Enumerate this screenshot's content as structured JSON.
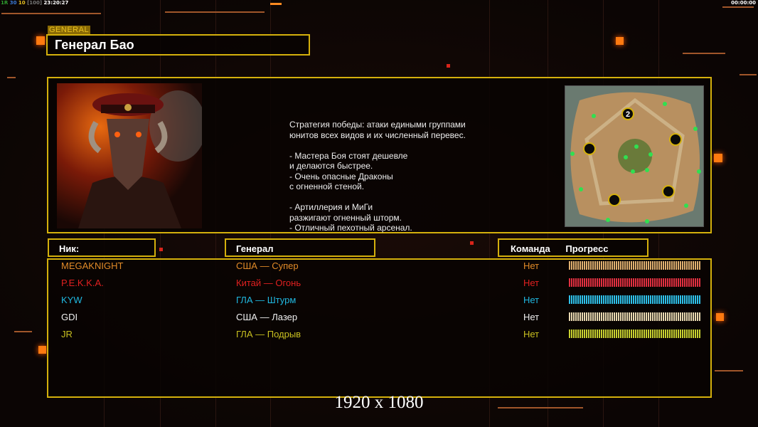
{
  "status_bar": {
    "left_parts": [
      {
        "text": "1R",
        "color": "#2fa02f"
      },
      {
        "text": "30",
        "color": "#3a7ad8"
      },
      {
        "text": "10",
        "color": "#e8c020"
      },
      {
        "text": "[100]",
        "color": "#777"
      },
      {
        "text": "23:20:27",
        "color": "#fff"
      }
    ],
    "right_time": "00:00:00"
  },
  "header": {
    "tag": "GENERAL",
    "title": "Генерал Бао"
  },
  "description": [
    "Стратегия победы: атаки едиными группами",
    "юнитов всех видов и их численный перевес.",
    "",
    "- Мастера Боя стоят дешевле",
    "и делаются быстрее.",
    "- Очень опасные Драконы",
    "с огненной стеной.",
    "",
    "- Артиллерия и МиГи",
    "разжигают огненный шторм.",
    "- Отличный пехотный арсенал."
  ],
  "map": {
    "player_marker": "2"
  },
  "columns": {
    "nick": "Ник:",
    "general": "Генерал",
    "team": "Команда",
    "progress": "Прогресс"
  },
  "players": [
    {
      "nick": "MEGAKNIGHT",
      "general": "США — Супер",
      "team": "Нет",
      "color": "#e08a28",
      "progress": 100
    },
    {
      "nick": "P.E.K.K.A.",
      "general": "Китай — Огонь",
      "team": "Нет",
      "color": "#e02020",
      "progress": 100
    },
    {
      "nick": "KYW",
      "general": "ГЛА — Штурм",
      "team": "Нет",
      "color": "#20b8e0",
      "progress": 100
    },
    {
      "nick": "GDI",
      "general": "США — Лазер",
      "team": "Нет",
      "color": "#f0f0f0",
      "progress": 100
    },
    {
      "nick": "JR",
      "general": "ГЛА — Подрыв",
      "team": "Нет",
      "color": "#c8c020",
      "progress": 100
    }
  ],
  "bar_colors": [
    "#e0b070",
    "#e03040",
    "#30c0e8",
    "#e8d8b0",
    "#c8d030"
  ],
  "resolution": "1920 x 1080"
}
